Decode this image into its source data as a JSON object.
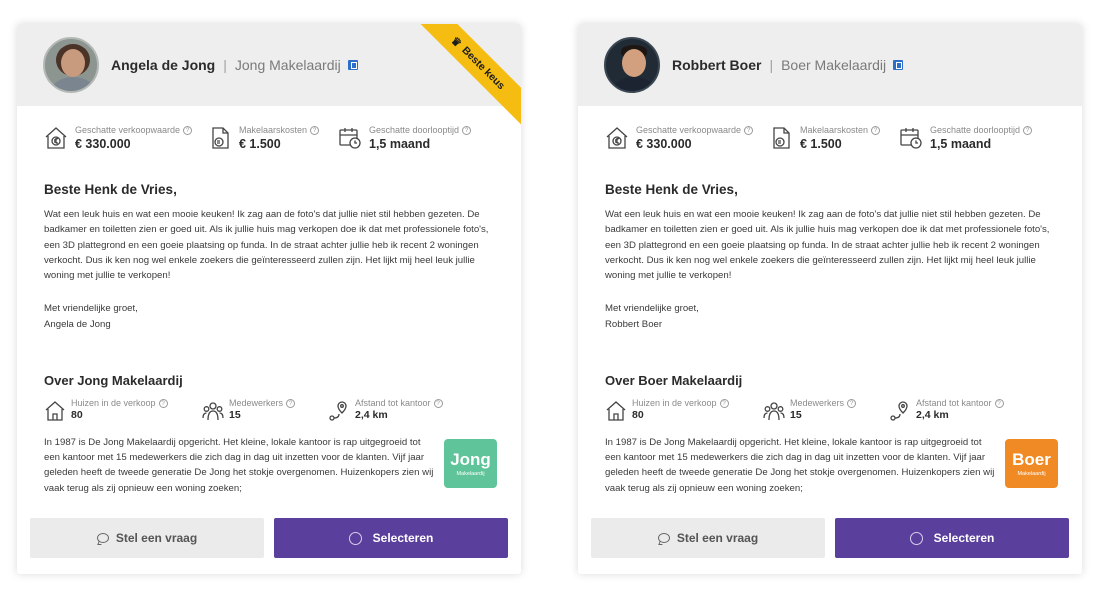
{
  "colors": {
    "brand_purple": "#5b3f9c",
    "ribbon_yellow": "#f5bd12",
    "logo_jong": "#5fc49a",
    "logo_boer": "#f08a24"
  },
  "stat_labels": {
    "value": "Geschatte verkoopwaarde",
    "costs": "Makelaarskosten",
    "duration": "Geschatte doorlooptijd"
  },
  "about_labels": {
    "houses": "Huizen in de verkoop",
    "staff": "Medewerkers",
    "distance": "Afstand tot kantoor"
  },
  "buttons": {
    "ask": "Stel een vraag",
    "select": "Selecteren"
  },
  "cards": [
    {
      "agent_name": "Angela de Jong",
      "separator": "|",
      "agency_name": "Jong Makelaardij",
      "ribbon": "Beste keus",
      "ribbon_icon": "crown-icon",
      "stats": {
        "value": "€ 330.000",
        "costs": "€ 1.500",
        "duration": "1,5 maand"
      },
      "greeting": "Beste Henk de Vries,",
      "message": "Wat een leuk huis en wat een mooie keuken! Ik zag aan de foto's dat jullie niet stil hebben gezeten. De badkamer en toiletten zien er goed uit. Als ik jullie huis mag verkopen doe ik dat met professionele foto's, een 3D plattegrond en een goeie plaatsing op funda. In de straat achter jullie heb ik recent 2 woningen verkocht. Dus ik ken nog wel enkele zoekers die geïnteresseerd zullen zijn. Het lijkt mij heel leuk jullie woning met jullie te verkopen!",
      "closing_line": "Met vriendelijke groet,",
      "signature": "Angela de Jong",
      "about_title": "Over Jong Makelaardij",
      "about_stats": {
        "houses": "80",
        "staff": "15",
        "distance": "2,4 km"
      },
      "about_text": "In 1987 is De Jong Makelaardij opgericht. Het kleine, lokale kantoor is rap uitgegroeid tot een kantoor met 15 medewerkers die zich dag in dag uit inzetten voor de klanten. Vijf jaar geleden heeft de tweede generatie De Jong het stokje overgenomen. Huizenkopers zien wij vaak terug als zij opnieuw een woning zoeken;",
      "logo_main": "Jong",
      "logo_sub": "Makelaardij"
    },
    {
      "agent_name": "Robbert Boer",
      "separator": "|",
      "agency_name": "Boer Makelaardij",
      "stats": {
        "value": "€ 330.000",
        "costs": "€ 1.500",
        "duration": "1,5 maand"
      },
      "greeting": "Beste Henk de Vries,",
      "message": "Wat een leuk huis en wat een mooie keuken! Ik zag aan de foto's dat jullie niet stil hebben gezeten. De badkamer en toiletten zien er goed uit. Als ik jullie huis mag verkopen doe ik dat met professionele foto's, een 3D plattegrond en een goeie plaatsing op funda. In de straat achter jullie heb ik recent 2 woningen verkocht. Dus ik ken nog wel enkele zoekers die geïnteresseerd zullen zijn. Het lijkt mij heel leuk jullie woning met jullie te verkopen!",
      "closing_line": "Met vriendelijke groet,",
      "signature": "Robbert Boer",
      "about_title": "Over Boer Makelaardij",
      "about_stats": {
        "houses": "80",
        "staff": "15",
        "distance": "2,4 km"
      },
      "about_text": "In 1987 is De Jong Makelaardij opgericht. Het kleine, lokale kantoor is rap uitgegroeid tot een kantoor met 15 medewerkers die zich dag in dag uit inzetten voor de klanten. Vijf jaar geleden heeft de tweede generatie De Jong het stokje overgenomen. Huizenkopers zien wij vaak terug als zij opnieuw een woning zoeken;",
      "logo_main": "Boer",
      "logo_sub": "Makelaardij"
    }
  ]
}
